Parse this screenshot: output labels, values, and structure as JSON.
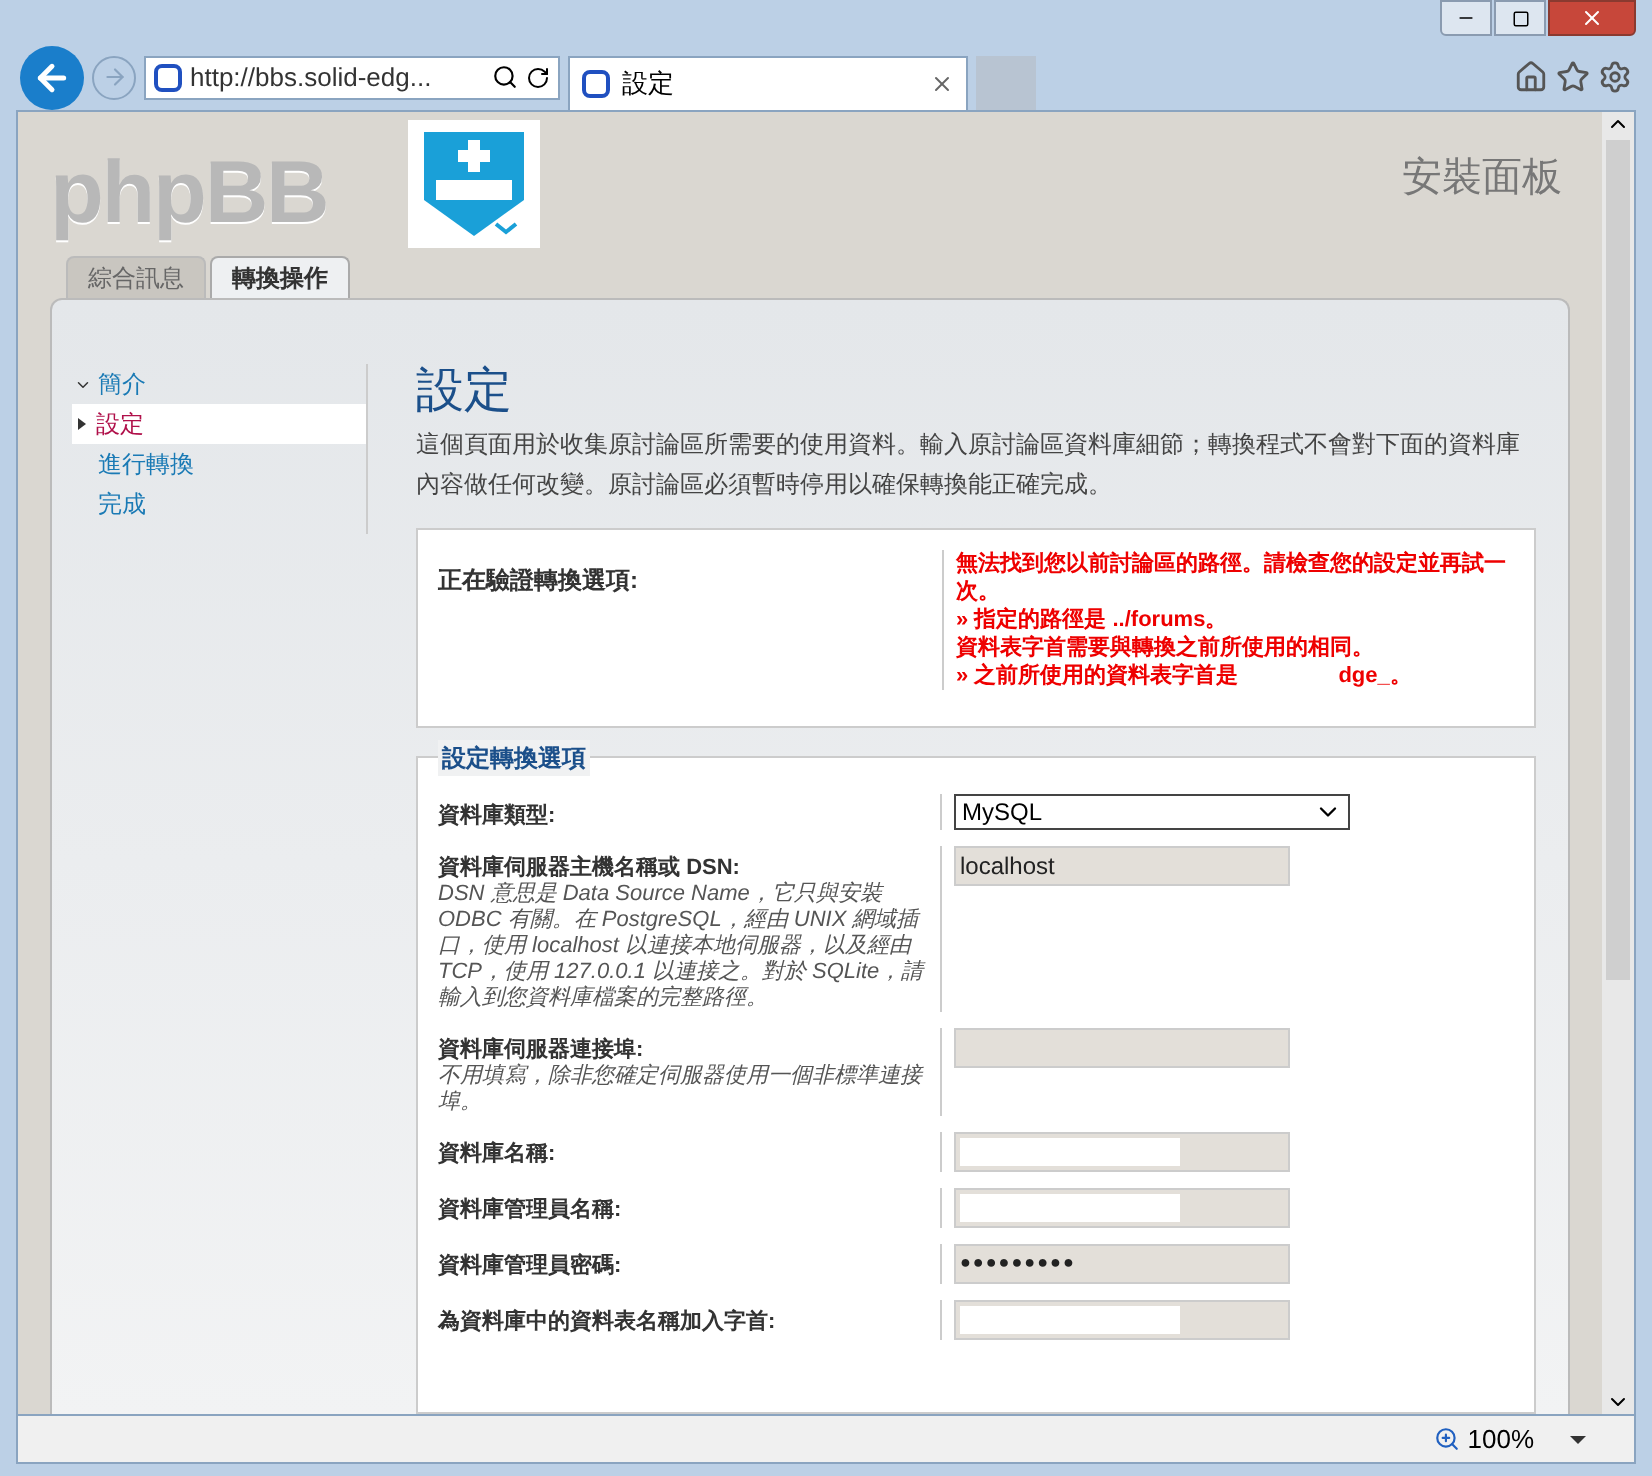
{
  "browser": {
    "address": "http://bbs.solid-edg...",
    "tab_title": "設定",
    "zoom": "100%"
  },
  "header": {
    "logo": "phpBB",
    "panel_title": "安裝面板"
  },
  "tabs": [
    {
      "label": "綜合訊息",
      "selected": false
    },
    {
      "label": "轉換操作",
      "selected": true
    }
  ],
  "sidebar": {
    "items": [
      {
        "label": "簡介",
        "selected": false,
        "kind": "expanded"
      },
      {
        "label": "設定",
        "selected": true,
        "kind": "current"
      },
      {
        "label": "進行轉換",
        "selected": false,
        "kind": "plain"
      },
      {
        "label": "完成",
        "selected": false,
        "kind": "plain"
      }
    ]
  },
  "page": {
    "title": "設定",
    "intro": "這個頁面用於收集原討論區所需要的使用資料。輸入原討論區資料庫細節；轉換程式不會對下面的資料庫內容做任何改變。原討論區必須暫時停用以確保轉換能正確完成。"
  },
  "verify": {
    "label": "正在驗證轉換選項:",
    "messages": [
      {
        "text": "無法找到您以前討論區的路徑。請檢查您的設定並再試一次。"
      },
      {
        "text": "» 指定的路徑是 **../forums**。"
      },
      {
        "text": "資料表字首需要與轉換之前所使用的相同。"
      },
      {
        "text": "» 之前所使用的資料表字首是",
        "tail": "dge_。"
      }
    ]
  },
  "options": {
    "legend": "設定轉換選項",
    "fields": [
      {
        "kind": "select",
        "label": "資料庫類型:",
        "value": "MySQL"
      },
      {
        "kind": "text",
        "label": "資料庫伺服器主機名稱或 **DSN**:",
        "hint": "DSN 意思是 Data Source Name，它只與安裝 ODBC 有關。在 PostgreSQL，經由 UNIX 網域插口，使用 localhost 以連接本地伺服器，以及經由 TCP，使用 127.0.0.1 以連接之。對於 SQLite，請輸入到您資料庫檔案的完整路徑。",
        "value": "localhost",
        "redacted": false
      },
      {
        "kind": "text",
        "label": "資料庫伺服器連接埠:",
        "hint": "不用填寫，除非您確定伺服器使用一個非標準連接埠。",
        "redacted": false
      },
      {
        "kind": "text",
        "label": "資料庫名稱:",
        "redacted": true
      },
      {
        "kind": "text",
        "label": "資料庫管理員名稱:",
        "redacted": true
      },
      {
        "kind": "password",
        "label": "資料庫管理員密碼:",
        "value": "●●●●●●●●●",
        "redacted": false
      },
      {
        "kind": "text",
        "label": "為資料庫中的資料表名稱加入字首:",
        "redacted": true
      }
    ]
  }
}
